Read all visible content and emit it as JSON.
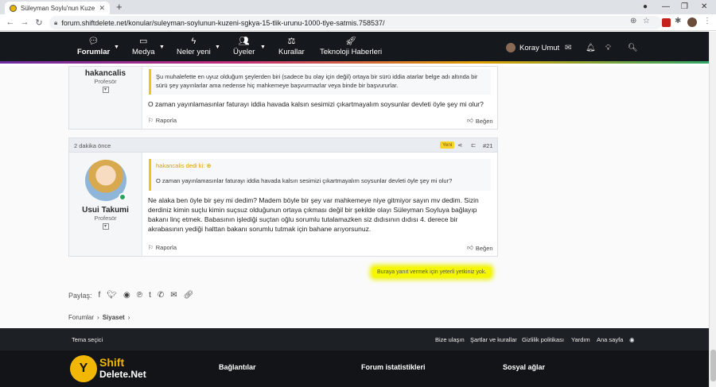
{
  "browser": {
    "tab_title": "Süleyman Soylu'nun Kuzeni Sgk...",
    "url": "forum.shiftdelete.net/konular/suleyman-soylunun-kuzeni-sgkya-15-tlik-urunu-1000-tlye-satmis.758537/"
  },
  "nav": {
    "items": [
      "Forumlar",
      "Medya",
      "Neler yeni",
      "Üyeler",
      "Kurallar",
      "Teknoloji Haberleri"
    ],
    "user": "Koray Umut"
  },
  "post1": {
    "user": "hakancalis",
    "role": "Profesör",
    "quote": "Şu muhalefette en uyuz olduğum şeylerden biri (sadece bu olay için değil) ortaya bir sürü iddia atarlar belge adı altında bir sürü şey yayınlarlar ama nedense hiç mahkemeye başvurmazlar veya binde bir başvururlar.",
    "text": "O zaman yayınlamasınlar faturayı iddia havada kalsın sesimizi çıkartmayalım soysunlar devleti öyle şey mi olur?",
    "report": "Raporla",
    "like": "Beğen"
  },
  "post2": {
    "time": "2 dakika önce",
    "badge": "Yeni",
    "number": "#21",
    "user": "Usui Takumi",
    "role": "Profesör",
    "quote_author": "hakancalis dedi ki:",
    "quote": "O zaman yayınlamasınlar faturayı iddia havada kalsın sesimizi çıkartmayalım soysunlar devleti öyle şey mi olur?",
    "text": "Ne alaka ben öyle bir şey mi dedim? Madem böyle bir şey var mahkemeye niye gitmiyor sayın mv dedim. Sizin derdiniz kimin suçlu kimin suçsuz olduğunun ortaya çıkması değil bir şekilde olayı Süleyman Soyluya bağlayıp bakanı linç etmek. Babasının işlediği suçtan oğlu sorumlu tutalamazken siz dıdısının dıdısı 4. derece bir akrabasının yediği halttan bakanı sorumlu tutmak için bahane arıyorsunuz.",
    "report": "Raporla",
    "like": "Beğen"
  },
  "no_reply": "Buraya yanıt vermek için yeterli yetkiniz yok.",
  "share_label": "Paylaş:",
  "breadcrumb": [
    "Forumlar",
    "Siyaset"
  ],
  "footer": {
    "theme": "Tema seçici",
    "links": [
      "Bize ulaşın",
      "Şartlar ve kurallar",
      "Gizlilik politikası",
      "Yardım",
      "Ana sayfa"
    ],
    "logo_top": "Shift",
    "logo_bottom": "Delete.Net",
    "columns": [
      "Bağlantılar",
      "Forum istatistikleri",
      "Sosyal ağlar"
    ]
  }
}
